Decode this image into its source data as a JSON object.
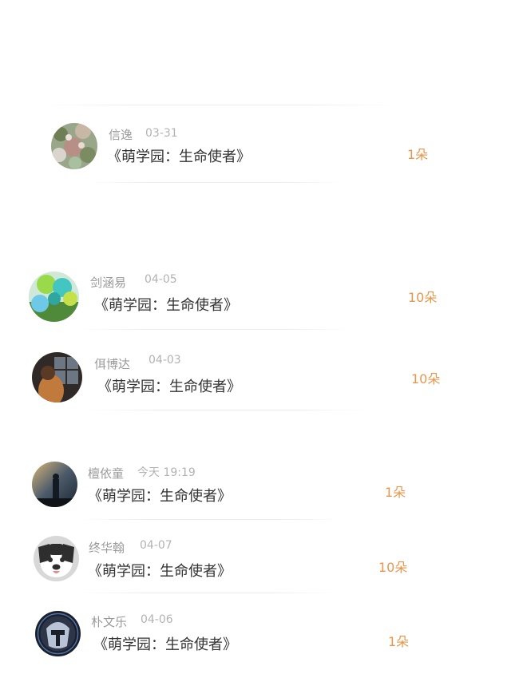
{
  "gifts": [
    {
      "name": "信逸",
      "date": "03-31",
      "title": "《萌学园：生命使者》",
      "count": "1朵",
      "avatar": "wreath-avatar"
    },
    {
      "name": "剑涵易",
      "date": "04-05",
      "title": "《萌学园：生命使者》",
      "count": "10朵",
      "avatar": "balloons-avatar"
    },
    {
      "name": "佴博达",
      "date": "04-03",
      "title": "《萌学园：生命使者》",
      "count": "10朵",
      "avatar": "window-girl-avatar"
    },
    {
      "name": "檀依童",
      "date": "今天 19:19",
      "title": "《萌学园：生命使者》",
      "count": "1朵",
      "avatar": "silhouette-avatar"
    },
    {
      "name": "终华翰",
      "date": "04-07",
      "title": "《萌学园：生命使者》",
      "count": "10朵",
      "avatar": "dog-avatar"
    },
    {
      "name": "朴文乐",
      "date": "04-06",
      "title": "《萌学园：生命使者》",
      "count": "1朵",
      "avatar": "helmet-avatar"
    }
  ]
}
